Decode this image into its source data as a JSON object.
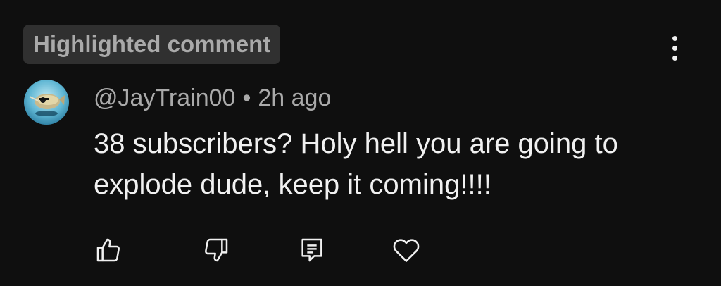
{
  "highlight_label": "Highlighted comment",
  "comment": {
    "author": "@JayTrain00",
    "separator": "•",
    "time": "2h ago",
    "text": "38 subscribers? Holy hell you are going to explode dude, keep it coming!!!!"
  },
  "icons": {
    "more": "more-vert-icon",
    "like": "thumbs-up-icon",
    "dislike": "thumbs-down-icon",
    "reply": "reply-icon",
    "heart": "heart-icon"
  },
  "colors": {
    "background": "#0f0f0f",
    "badge_bg": "#303030",
    "secondary_text": "#aaaaaa",
    "primary_text": "#f1f1f1"
  }
}
